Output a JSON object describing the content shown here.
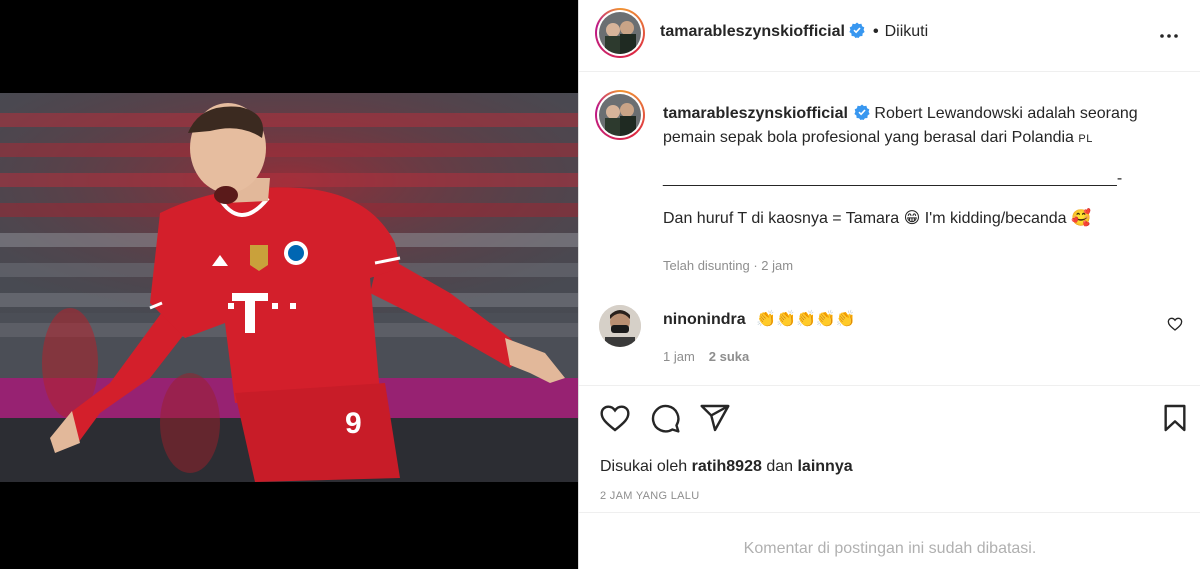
{
  "post": {
    "photo_alt": "player-celebration-photo"
  },
  "header": {
    "username": "tamarableszynskiofficial",
    "separator": "•",
    "follow_state": "Diikuti"
  },
  "caption": {
    "username": "tamarableszynskiofficial",
    "line1": "Robert Lewandowski adalah seorang",
    "line2": "pemain sepak bola profesional yang berasal dari Polandia",
    "flag": "PL",
    "divider": "___________________________________________________-",
    "line3": "Dan huruf T di kaosnya = Tamara",
    "emoji1": "😁",
    "line3b": "I'm kidding/becanda",
    "emoji2": "🥰",
    "edited": "Telah disunting · 2 jam"
  },
  "comment": {
    "username": "ninonindra",
    "emojis": "👏👏👏👏👏",
    "time": "1 jam",
    "likes": "2 suka"
  },
  "engagement": {
    "liked_by_prefix": "Disukai oleh",
    "liked_by_user": "ratih8928",
    "and": "dan",
    "others": "lainnya",
    "time_ago": "2 JAM YANG LALU"
  },
  "footer": {
    "restricted_text": "Komentar di postingan ini sudah dibatasi."
  },
  "colors": {
    "verified": "#3897f0",
    "text_primary": "#262626",
    "text_secondary": "#8e8e8e",
    "jersey_red": "#d31f2b"
  },
  "icons": [
    "verified-badge-icon",
    "more-options-icon",
    "heart-icon",
    "comment-icon",
    "share-icon",
    "bookmark-icon",
    "comment-heart-icon"
  ]
}
